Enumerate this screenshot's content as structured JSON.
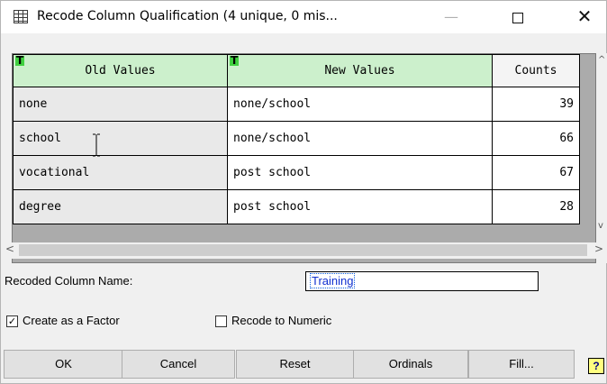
{
  "window": {
    "title": "Recode Column Qualification (4 unique, 0 mis...",
    "minimize_glyph": "—",
    "close_glyph": "✕"
  },
  "grid": {
    "headers": {
      "old": "Old Values",
      "new": "New Values",
      "counts": "Counts",
      "badge": "T"
    },
    "rows": [
      {
        "old": "none",
        "new": "none/school",
        "count": "39"
      },
      {
        "old": "school",
        "new": "none/school",
        "count": "66"
      },
      {
        "old": "vocational",
        "new": "post school",
        "count": "67"
      },
      {
        "old": "degree",
        "new": "post school",
        "count": "28"
      }
    ],
    "header_color": "#ccf0cc",
    "badge_color": "#40d040"
  },
  "scroll": {
    "left_arrow": "<",
    "right_arrow": ">",
    "up_arrow": "^",
    "down_arrow": "v"
  },
  "form": {
    "recoded_label": "Recoded Column Name:",
    "recoded_value": "Training",
    "factor_label": "Create as a Factor",
    "factor_checked": true,
    "numeric_label": "Recode to Numeric",
    "numeric_checked": false
  },
  "buttons": {
    "ok": "OK",
    "cancel": "Cancel",
    "reset": "Reset",
    "ordinals": "Ordinals",
    "fill": "Fill...",
    "help": "?"
  }
}
